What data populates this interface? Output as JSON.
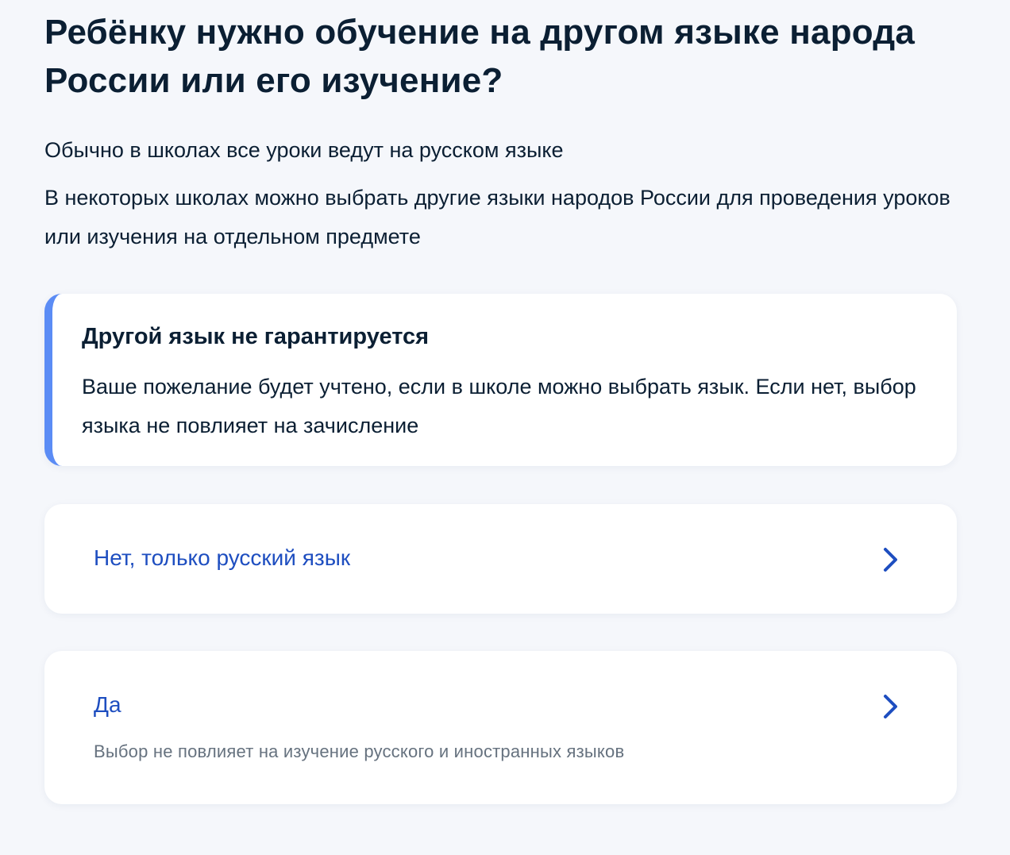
{
  "question": {
    "title": "Ребёнку нужно обучение на другом языке народа России или его изучение?",
    "intro_1": "Обычно в школах все уроки ведут на русском языке",
    "intro_2": "В некоторых школах можно выбрать другие языки народов России для проведения уроков или изучения на отдельном предмете"
  },
  "info": {
    "title": "Другой язык не гарантируется",
    "text": "Ваше пожелание будет учтено, если в школе можно выбрать язык. Если нет, выбор языка не повлияет на зачисление",
    "accent_color": "#5b8cf5"
  },
  "options": [
    {
      "label": "Нет, только русский язык",
      "icon": "chevron-right-icon"
    },
    {
      "label": "Да",
      "description": "Выбор не повлияет на изучение русского и иностранных языков",
      "icon": "chevron-right-icon"
    }
  ],
  "colors": {
    "link": "#1e4ec0",
    "text": "#0b1f33",
    "secondary_text": "#66727f",
    "background": "#f5f7fb"
  }
}
